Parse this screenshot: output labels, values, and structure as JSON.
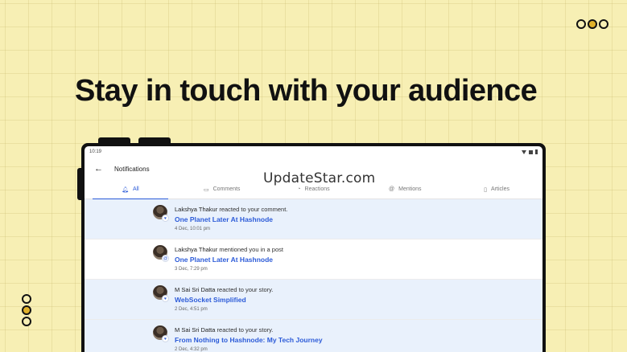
{
  "headline": "Stay in touch with your audience",
  "watermark": "UpdateStar.com",
  "statusbar": {
    "time": "10:19"
  },
  "appbar": {
    "title": "Notifications",
    "back_icon": "arrow-left-icon"
  },
  "tabs": [
    {
      "label": "All",
      "icon": "bell-icon",
      "active": true
    },
    {
      "label": "Comments",
      "icon": "comment-icon",
      "active": false
    },
    {
      "label": "Reactions",
      "icon": "thumbs-up-icon",
      "active": false
    },
    {
      "label": "Mentions",
      "icon": "at-icon",
      "active": false
    },
    {
      "label": "Articles",
      "icon": "document-icon",
      "active": false
    }
  ],
  "notifications": [
    {
      "actor": "Lakshya Thakur",
      "action": "reacted to your comment.",
      "title": "One Planet Later At Hashnode",
      "time": "4 Dec, 10:01 pm",
      "unread": true
    },
    {
      "actor": "Lakshya Thakur",
      "action": "mentioned you in a post",
      "title": "One Planet Later At Hashnode",
      "time": "3 Dec, 7:29 pm",
      "unread": false
    },
    {
      "actor": "M Sai Sri Datta",
      "action": "reacted to your story.",
      "title": "WebSocket Simplified",
      "time": "2 Dec, 4:51 pm",
      "unread": true
    },
    {
      "actor": "M Sai Sri Datta",
      "action": "reacted to your story.",
      "title": "From Nothing to Hashnode: My Tech Journey",
      "time": "2 Dec, 4:32 pm",
      "unread": true
    }
  ],
  "colors": {
    "background": "#f7efb4",
    "accent": "#2c5bd8",
    "unread_row": "#e9f1fc",
    "dot_fill": "#e0b12a"
  }
}
